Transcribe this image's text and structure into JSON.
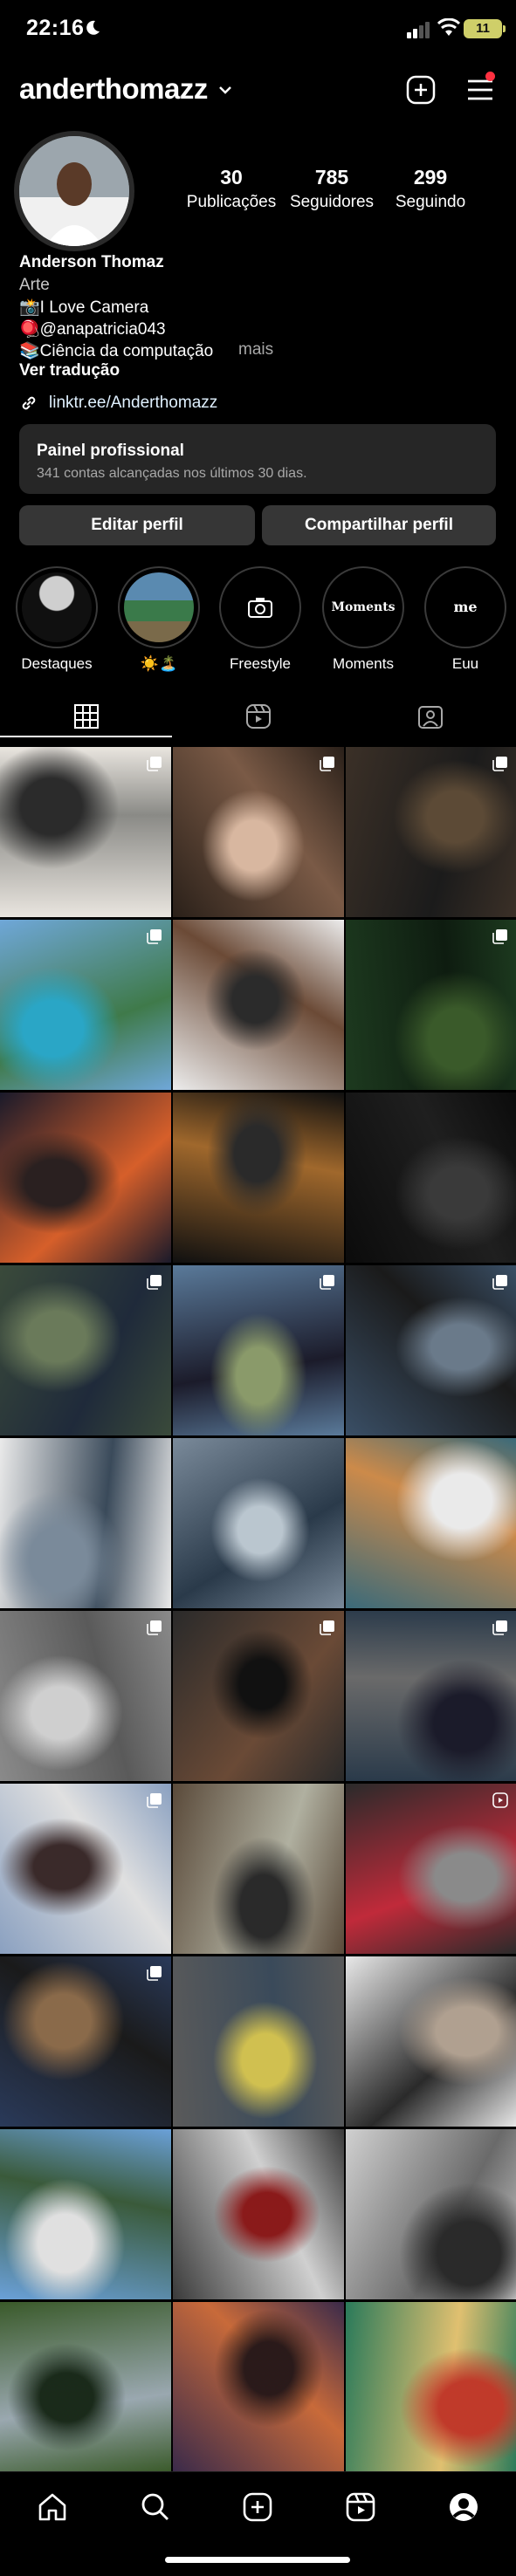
{
  "status": {
    "time": "22:16",
    "battery": "11"
  },
  "header": {
    "username": "anderthomazz"
  },
  "stats": [
    {
      "value": "30",
      "label": "Publicações"
    },
    {
      "value": "785",
      "label": "Seguidores"
    },
    {
      "value": "299",
      "label": "Seguindo"
    }
  ],
  "bio": {
    "name": "Anderson Thomaz",
    "category": "Arte",
    "line1": "📸I Love Camera",
    "line2": "🪀@anapatricia043",
    "line3": "📚Ciência da computação",
    "more": "mais",
    "translate": "Ver tradução",
    "link": "linktr.ee/Anderthomazz"
  },
  "dashboard": {
    "title": "Painel profissional",
    "subtitle": "341 contas alcançadas nos últimos 30 dias."
  },
  "buttons": {
    "edit": "Editar perfil",
    "share": "Compartilhar perfil"
  },
  "highlights": [
    {
      "label": "Destaques"
    },
    {
      "label": "☀️🏝️"
    },
    {
      "label": "Freestyle"
    },
    {
      "label": "Moments",
      "cover_text": "Moments"
    },
    {
      "label": "Euu",
      "cover_text": "me"
    }
  ],
  "tabs": {
    "active": "grid",
    "icons": [
      "grid-icon",
      "reels-icon",
      "tagged-icon"
    ]
  },
  "grid": {
    "posts": [
      {
        "name": "post-couple-white",
        "multi": true,
        "colors": [
          "#e9e5df",
          "#8a8a86",
          "#2b2b2b"
        ]
      },
      {
        "name": "post-couple-kiss",
        "multi": true,
        "colors": [
          "#2a2019",
          "#7a5a46",
          "#d8b7a0"
        ]
      },
      {
        "name": "post-slippers",
        "multi": true,
        "colors": [
          "#3b3027",
          "#1b1b1b",
          "#5c4a36"
        ]
      },
      {
        "name": "post-pool-resort",
        "multi": true,
        "colors": [
          "#6fa7d8",
          "#3f7a4a",
          "#2aa6c6"
        ]
      },
      {
        "name": "post-selfie-car",
        "multi": false,
        "colors": [
          "#ececec",
          "#6b4a36",
          "#2b2b2b"
        ]
      },
      {
        "name": "post-forest-girl",
        "multi": true,
        "colors": [
          "#1d3a1f",
          "#0e1c10",
          "#3a5a2a"
        ]
      },
      {
        "name": "post-sunset-silhouette",
        "multi": false,
        "colors": [
          "#1a1a2a",
          "#d65f2a",
          "#2a2020"
        ]
      },
      {
        "name": "post-dog",
        "multi": false,
        "colors": [
          "#101010",
          "#a0682c",
          "#2a2a2a"
        ]
      },
      {
        "name": "post-camera",
        "multi": false,
        "colors": [
          "#0b0b0b",
          "#1f1f1f",
          "#3a3a3a"
        ]
      },
      {
        "name": "post-street-walk",
        "multi": true,
        "colors": [
          "#3a4a3a",
          "#1f2a3a",
          "#6a7a5a"
        ]
      },
      {
        "name": "post-beach-boy",
        "multi": true,
        "colors": [
          "#5a7a9a",
          "#1b1b2a",
          "#8a9a6a"
        ]
      },
      {
        "name": "post-profile-side",
        "multi": true,
        "colors": [
          "#3a4f66",
          "#1a1a1a",
          "#6a7a8a"
        ]
      },
      {
        "name": "post-collage-skate",
        "multi": false,
        "colors": [
          "#eaeaea",
          "#3a4a5a",
          "#7a8a9a"
        ]
      },
      {
        "name": "post-collage-hype",
        "multi": false,
        "colors": [
          "#7a8a9a",
          "#2a3a4a",
          "#bac6cf"
        ]
      },
      {
        "name": "post-collage-mural",
        "multi": false,
        "colors": [
          "#3a6a7a",
          "#cc8a4a",
          "#eaeaea"
        ]
      },
      {
        "name": "post-sitting-rooftop",
        "multi": true,
        "colors": [
          "#8a8a8a",
          "#5a5a5a",
          "#cfcfcf"
        ]
      },
      {
        "name": "post-laptop",
        "multi": true,
        "colors": [
          "#2a2a2a",
          "#6a4a36",
          "#111111"
        ]
      },
      {
        "name": "post-group",
        "multi": true,
        "colors": [
          "#2a3a4a",
          "#6a6a6a",
          "#1b1b2a"
        ]
      },
      {
        "name": "post-two-friends",
        "multi": true,
        "colors": [
          "#8aa0c0",
          "#e0e0e0",
          "#3a2a2a"
        ]
      },
      {
        "name": "post-three-friends",
        "multi": false,
        "colors": [
          "#5a4a3a",
          "#b0b0a0",
          "#2a2a2a"
        ]
      },
      {
        "name": "post-escalator",
        "multi": false,
        "reel": true,
        "colors": [
          "#2a2a2a",
          "#c02a3a",
          "#8a8a8a"
        ]
      },
      {
        "name": "post-city-night",
        "multi": true,
        "colors": [
          "#2a3a5a",
          "#1a1a1a",
          "#8a6a4a"
        ]
      },
      {
        "name": "post-parking-dance",
        "multi": false,
        "colors": [
          "#5a5a5a",
          "#3a4a5a",
          "#d0c050"
        ]
      },
      {
        "name": "post-mall-selfie",
        "multi": false,
        "colors": [
          "#e8e8e8",
          "#2a2a2a",
          "#b0a090"
        ]
      },
      {
        "name": "post-cap-portrait",
        "multi": false,
        "colors": [
          "#6aa0d8",
          "#3a5a3a",
          "#e0e0e0"
        ]
      },
      {
        "name": "post-jacket-street",
        "multi": false,
        "colors": [
          "#3a3a3a",
          "#d0d0d0",
          "#8a1a1a"
        ]
      },
      {
        "name": "post-dome",
        "multi": false,
        "colors": [
          "#d0d0d0",
          "#6a6a6a",
          "#2a2a2a"
        ]
      },
      {
        "name": "post-bike-trail",
        "multi": false,
        "colors": [
          "#3a5a2a",
          "#9aa8b0",
          "#1a2a1a"
        ]
      },
      {
        "name": "post-sunset-sky",
        "multi": false,
        "colors": [
          "#3a2a4a",
          "#c86a3a",
          "#2a1a1a"
        ]
      },
      {
        "name": "post-boat",
        "multi": false,
        "colors": [
          "#2a7a5a",
          "#e0c070",
          "#c03a2a"
        ]
      }
    ]
  },
  "nav": {
    "items": [
      "home-icon",
      "search-icon",
      "create-icon",
      "reels-icon",
      "profile-icon"
    ]
  }
}
